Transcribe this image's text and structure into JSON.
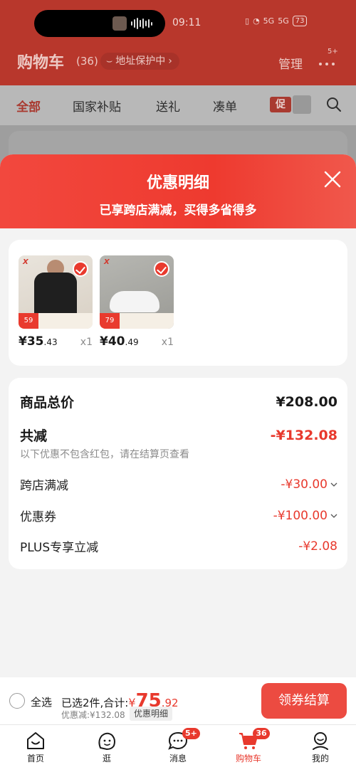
{
  "status_bar": {
    "time": "09:11",
    "network_1": "5G",
    "network_2": "5G",
    "battery": "73"
  },
  "header": {
    "title": "购物车",
    "count": "(36)",
    "address_protect": "地址保护中",
    "manage": "管理",
    "more_badge": "5+"
  },
  "tabs": [
    {
      "label": "全部"
    },
    {
      "label": "国家补贴"
    },
    {
      "label": "送礼"
    },
    {
      "label": "凑单"
    }
  ],
  "promo_tag": "促",
  "sheet": {
    "title": "优惠明细",
    "subtitle": "已享跨店满减，买得多省得多"
  },
  "products": [
    {
      "price_int": "¥35",
      "price_dec": ".43",
      "qty": "x1",
      "tag": "59",
      "image_icon": "tshirt-product-image"
    },
    {
      "price_int": "¥40",
      "price_dec": ".49",
      "qty": "x1",
      "tag": "79",
      "image_icon": "sneaker-product-image"
    }
  ],
  "summary": {
    "total_label": "商品总价",
    "total_value": "¥208.00",
    "reduce_label": "共减",
    "reduce_value": "-¥132.08",
    "note": "以下优惠不包含红包，请在结算页查看",
    "items": [
      {
        "label": "跨店满减",
        "value": "-¥30.00"
      },
      {
        "label": "优惠券",
        "value": "-¥100.00"
      },
      {
        "label": "PLUS专享立减",
        "value": "-¥2.08"
      }
    ]
  },
  "checkout": {
    "select_all": "全选",
    "picked": "已选2件,合计:",
    "currency": "¥",
    "amount_int": "75",
    "amount_dec": ".92",
    "saved": "优惠减:¥132.08",
    "detail": "优惠明细",
    "pay": "领券结算"
  },
  "tabbar": [
    {
      "label": "首页",
      "icon": "home-icon"
    },
    {
      "label": "逛",
      "icon": "browse-icon"
    },
    {
      "label": "消息",
      "icon": "message-icon",
      "badge": "5+"
    },
    {
      "label": "购物车",
      "icon": "cart-icon",
      "badge": "36"
    },
    {
      "label": "我的",
      "icon": "profile-icon"
    }
  ],
  "colors": {
    "brand_red": "#e8392d",
    "header_red": "#ee3a2f",
    "overlay_red": "#b8372c"
  }
}
